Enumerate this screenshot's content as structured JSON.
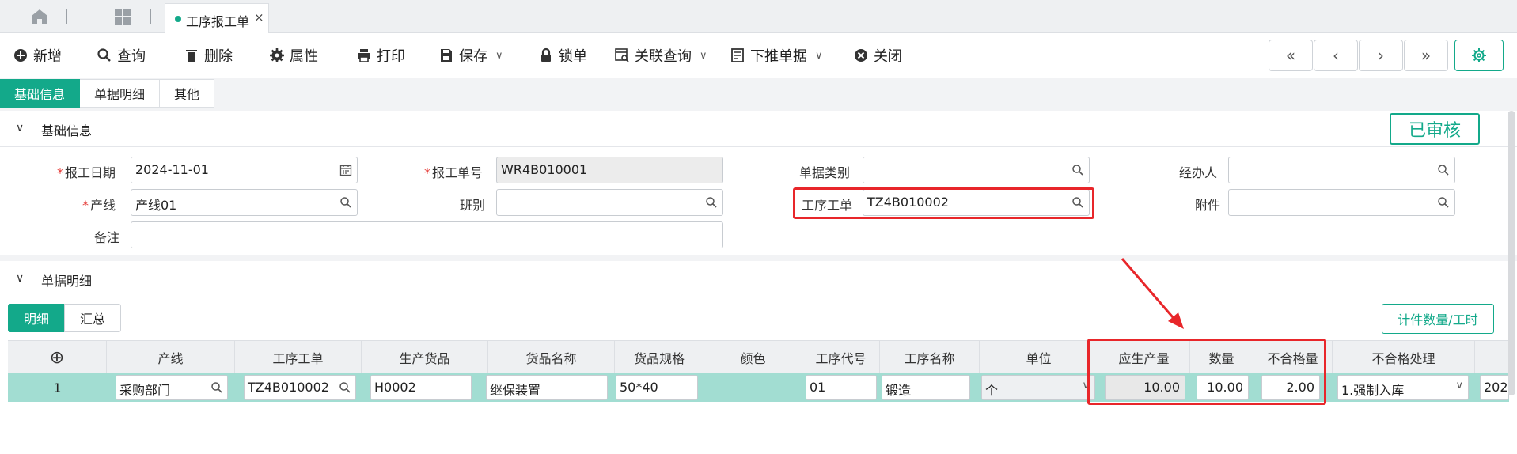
{
  "tabs": {
    "active_label": "工序报工单",
    "close_glyph": "×"
  },
  "toolbar": {
    "add": "新增",
    "query": "查询",
    "delete": "删除",
    "props": "属性",
    "print": "打印",
    "save": "保存",
    "lock": "锁单",
    "related": "关联查询",
    "push": "下推单据",
    "close": "关闭",
    "nav_first": "«",
    "nav_prev": "‹",
    "nav_next": "›",
    "nav_last": "»"
  },
  "section_tabs": [
    "基础信息",
    "单据明细",
    "其他"
  ],
  "basic": {
    "header": "基础信息",
    "status": "已审核",
    "fields": {
      "report_date_label": "报工日期",
      "report_date": "2024-11-01",
      "report_no_label": "报工单号",
      "report_no": "WR4B010001",
      "doc_type_label": "单据类别",
      "doc_type": "",
      "handler_label": "经办人",
      "handler": "",
      "line_label": "产线",
      "line": "产线01",
      "shift_label": "班别",
      "shift": "",
      "process_order_label": "工序工单",
      "process_order": "TZ4B010002",
      "attachment_label": "附件",
      "attachment": "",
      "remark_label": "备注",
      "remark": ""
    }
  },
  "detail": {
    "header": "单据明细",
    "tabs": [
      "明细",
      "汇总"
    ],
    "piece_button": "计件数量/工时",
    "add_glyph": "⊕",
    "columns": [
      "产线",
      "工序工单",
      "生产货品",
      "货品名称",
      "货品规格",
      "颜色",
      "工序代号",
      "工序名称",
      "单位",
      "应生产量",
      "数量",
      "不合格量",
      "不合格处理"
    ],
    "row": {
      "index": "1",
      "line": "采购部门",
      "process_order": "TZ4B010002",
      "product": "H0002",
      "product_name": "继保装置",
      "spec": "50*40",
      "color": "",
      "process_code": "01",
      "process_name": "锻造",
      "unit": "个",
      "planned_qty": "10.00",
      "qty": "10.00",
      "defect_qty": "2.00",
      "defect_handling": "1.强制入库",
      "next_col": "202"
    }
  },
  "colors": {
    "accent": "#13a98a",
    "highlight": "#e8262a",
    "row_selected": "#a2ddd2"
  }
}
